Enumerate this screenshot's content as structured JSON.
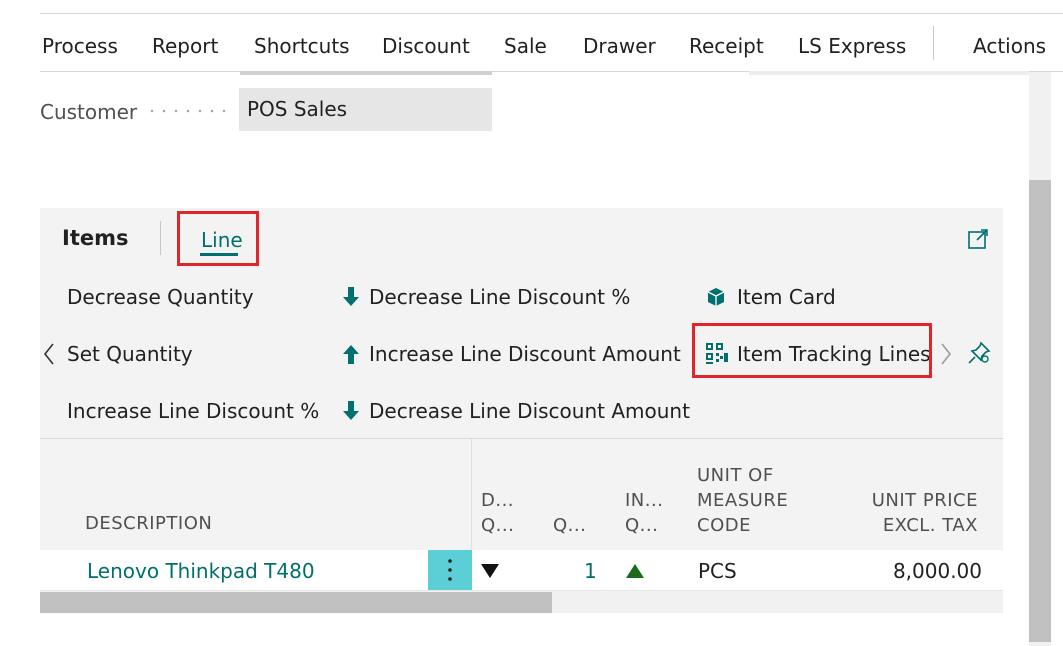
{
  "menu": {
    "items": [
      "Process",
      "Report",
      "Shortcuts",
      "Discount",
      "Sale",
      "Drawer",
      "Receipt",
      "LS Express"
    ],
    "actions_label": "Actions"
  },
  "customer": {
    "label": "Customer",
    "value": "POS Sales"
  },
  "items_panel": {
    "title": "Items",
    "tab_line": "Line",
    "actions": {
      "decrease_quantity": "Decrease Quantity",
      "set_quantity": "Set Quantity",
      "increase_line_discount_pct": "Increase Line Discount %",
      "decrease_line_discount_pct": "Decrease Line Discount %",
      "increase_line_discount_amount": "Increase Line Discount Amount",
      "decrease_line_discount_amount": "Decrease Line Discount Amount",
      "item_card": "Item Card",
      "item_tracking_lines": "Item Tracking Lines"
    }
  },
  "table": {
    "headers": {
      "description": "DESCRIPTION",
      "dq_line1": "D...",
      "dq_line2": "Q...",
      "q": "Q...",
      "iq_line1": "IN...",
      "iq_line2": "Q...",
      "uom_line1": "UNIT OF",
      "uom_line2": "MEASURE",
      "uom_line3": "CODE",
      "price_line1": "UNIT PRICE",
      "price_line2": "EXCL. TAX"
    },
    "rows": [
      {
        "description": "Lenovo Thinkpad T480",
        "quantity": "1",
        "uom": "PCS",
        "unit_price": "8,000.00"
      }
    ]
  },
  "colors": {
    "accent": "#00706e",
    "highlight_box": "#e0262b",
    "row_menu": "#5ccfd6",
    "increase_arrow": "#1d6a1d"
  }
}
